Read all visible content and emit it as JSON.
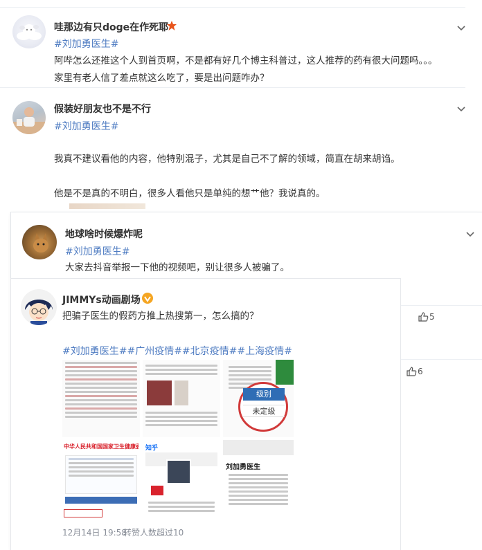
{
  "colors": {
    "link": "#4f7cc2",
    "text": "#333333",
    "muted": "#8a8f99",
    "badge": "#e8541c",
    "red_brand": "#d9232d"
  },
  "comments": [
    {
      "username": "哇那边有只doge在作死耶",
      "badge_icon": "red-star-badge-icon",
      "tag": "#刘加勇医生#",
      "lines": [
        "阿哔怎么还推这个人到首页啊，不是都有好几个博主科普过，这人推荐的药有很大问题吗。。。",
        "家里有老人信了差点就这么吃了，要是出问题咋办？"
      ]
    },
    {
      "username": "假装好朋友也不是不行",
      "tag": "#刘加勇医生#",
      "lines": [
        "我真不建议看他的内容，他特别混子，尤其是自己不了解的领域，简直在胡来胡诌。",
        "他是不是真的不明白，很多人看他只是单纯的想艹他？我说真的。"
      ]
    },
    {
      "username": "地球啥时候爆炸呢",
      "tag": "#刘加勇医生#",
      "lines": [
        "大家去抖音举报一下他的视频吧，别让很多人被骗了。"
      ]
    },
    {
      "username": "JIMMYs动画剧场",
      "badge_icon": "verified-v-badge-icon",
      "lines": [
        "把骗子医生的假药方推上热搜第一，怎么搞的？"
      ],
      "tags": "#刘加勇医生##广州疫情##北京疫情##上海疫情#",
      "timestamp": "12月14日 19:58",
      "forward_text": "转赞人数超过10"
    }
  ],
  "like_counts": {
    "first": "5",
    "second": "6"
  },
  "image_grid": {
    "level_label": "级别",
    "level_value": "未定级",
    "commission_title": "中华人民共和国国家卫生健康委员会",
    "zhihu": "知乎",
    "profile_name": "刘加勇医生"
  }
}
